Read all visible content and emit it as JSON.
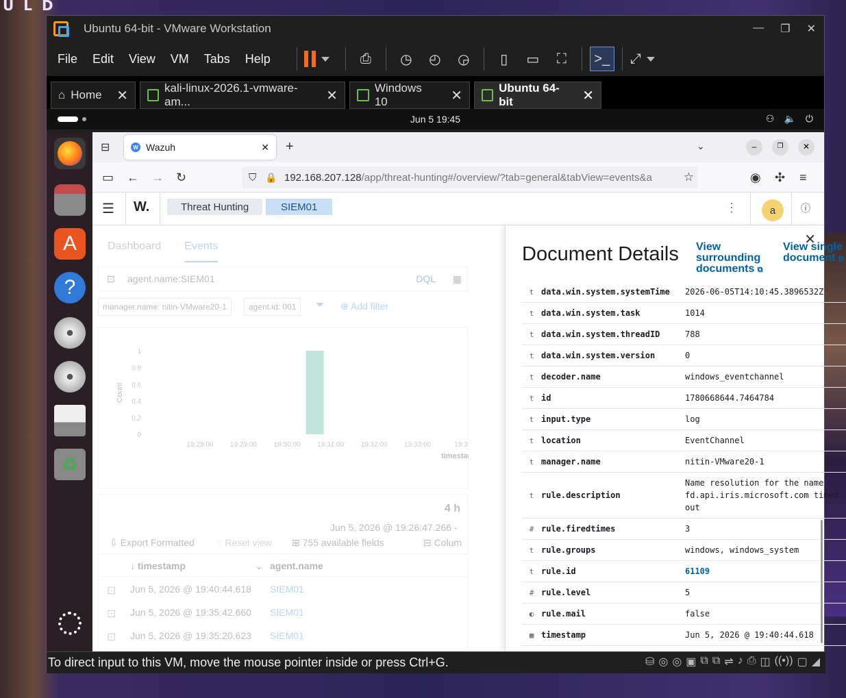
{
  "vmware": {
    "title": "Ubuntu 64-bit - VMware Workstation",
    "menu": [
      "File",
      "Edit",
      "View",
      "VM",
      "Tabs",
      "Help"
    ],
    "tabs": [
      {
        "label": "Home"
      },
      {
        "label": "kali-linux-2026.1-vmware-am..."
      },
      {
        "label": "Windows 10"
      },
      {
        "label": "Ubuntu 64-bit"
      }
    ],
    "status_text": "To direct input to this VM, move the mouse pointer inside or press Ctrl+G."
  },
  "ubuntu": {
    "clock": "Jun 5  19:45"
  },
  "browser": {
    "tab_title": "Wazuh",
    "url_host": "192.168.207.128",
    "url_path": "/app/threat-hunting#/overview/?tab=general&tabView=events&a"
  },
  "wazuh": {
    "logo": "W.",
    "breadcrumb": [
      "Threat Hunting",
      "SIEM01"
    ],
    "avatar": "a",
    "tabs": [
      "Dashboard",
      "Events"
    ],
    "query": "agent.name:SIEM01",
    "query_lang": "DQL",
    "filters": [
      "manager.name: nitin-VMware20-1",
      "agent.id: 001"
    ],
    "add_filter": "Add filter",
    "chart": {
      "ylabel": "Count",
      "yticks": [
        "1",
        "0.8",
        "0.6",
        "0.4",
        "0.2",
        "0"
      ],
      "xticks": [
        "19:28:00",
        "19:29:00",
        "19:30:00",
        "19:31:00",
        "19:32:00",
        "19:33:00",
        "19:3"
      ],
      "xlabel": "timestam"
    },
    "hits": "4 h",
    "range_start": "Jun 5, 2026 @ 19:26:47.266 -",
    "toolbar": {
      "export": "Export Formatted",
      "reset": "Reset view",
      "fields": "755 available fields",
      "columns": "Colum"
    },
    "columns": [
      "timestamp",
      "agent.name"
    ],
    "rows": [
      {
        "timestamp": "Jun 5, 2026 @ 19:40:44.618",
        "agent": "SIEM01"
      },
      {
        "timestamp": "Jun 5, 2026 @ 19:35:42.660",
        "agent": "SIEM01"
      },
      {
        "timestamp": "Jun 5, 2026 @ 19:35:20.623",
        "agent": "SIEM01"
      }
    ]
  },
  "chart_data": {
    "type": "bar",
    "categories": [
      "19:28:00",
      "19:29:00",
      "19:30:00",
      "19:31:00",
      "19:32:00",
      "19:33:00"
    ],
    "values": [
      0,
      0,
      0,
      1,
      0,
      0
    ],
    "ylabel": "Count",
    "xlabel": "timestam",
    "ylim": [
      0,
      1
    ],
    "color": "#54b399"
  },
  "flyout": {
    "title": "Document Details",
    "link_surrounding": "View surrounding documents",
    "link_single": "View single document",
    "fields": [
      {
        "type": "t",
        "key": "data.win.system.systemTime",
        "value": "2026-06-05T14:10:45.3896532Z"
      },
      {
        "type": "t",
        "key": "data.win.system.task",
        "value": "1014"
      },
      {
        "type": "t",
        "key": "data.win.system.threadID",
        "value": "788"
      },
      {
        "type": "t",
        "key": "data.win.system.version",
        "value": "0"
      },
      {
        "type": "t",
        "key": "decoder.name",
        "value": "windows_eventchannel"
      },
      {
        "type": "t",
        "key": "id",
        "value": "1780668644.7464784"
      },
      {
        "type": "t",
        "key": "input.type",
        "value": "log"
      },
      {
        "type": "t",
        "key": "location",
        "value": "EventChannel"
      },
      {
        "type": "t",
        "key": "manager.name",
        "value": "nitin-VMware20-1"
      },
      {
        "type": "t",
        "key": "rule.description",
        "value": "Name resolution for the name fd.api.iris.microsoft.com timed out"
      },
      {
        "type": "#",
        "key": "rule.firedtimes",
        "value": "3"
      },
      {
        "type": "t",
        "key": "rule.groups",
        "value": "windows, windows_system"
      },
      {
        "type": "t",
        "key": "rule.id",
        "value": "61109",
        "link": true
      },
      {
        "type": "#",
        "key": "rule.level",
        "value": "5"
      },
      {
        "type": "◐",
        "key": "rule.mail",
        "value": "false"
      },
      {
        "type": "▦",
        "key": "timestamp",
        "value": "Jun 5, 2026 @ 19:40:44.618"
      }
    ]
  }
}
